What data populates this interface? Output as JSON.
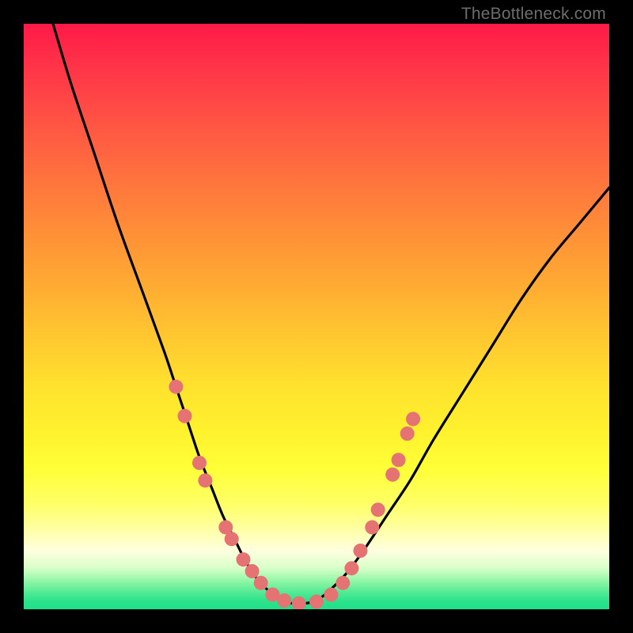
{
  "watermark": "TheBottleneck.com",
  "colors": {
    "page_bg": "#000000",
    "curve_stroke": "#000000",
    "marker_fill": "#e57373",
    "gradient_stops": [
      {
        "pct": 0,
        "color": "#ff1948"
      },
      {
        "pct": 6,
        "color": "#ff2f48"
      },
      {
        "pct": 14,
        "color": "#ff4a46"
      },
      {
        "pct": 24,
        "color": "#ff6b3f"
      },
      {
        "pct": 34,
        "color": "#ff8a38"
      },
      {
        "pct": 44,
        "color": "#ffa933"
      },
      {
        "pct": 54,
        "color": "#ffc930"
      },
      {
        "pct": 62,
        "color": "#ffe22e"
      },
      {
        "pct": 70,
        "color": "#fff22e"
      },
      {
        "pct": 76,
        "color": "#ffff38"
      },
      {
        "pct": 82,
        "color": "#ffff66"
      },
      {
        "pct": 86,
        "color": "#ffffa0"
      },
      {
        "pct": 90,
        "color": "#ffffe0"
      },
      {
        "pct": 93,
        "color": "#d8ffc8"
      },
      {
        "pct": 95,
        "color": "#96f7a8"
      },
      {
        "pct": 97,
        "color": "#56eb96"
      },
      {
        "pct": 98.5,
        "color": "#2de38c"
      },
      {
        "pct": 100,
        "color": "#1ee088"
      }
    ]
  },
  "chart_data": {
    "type": "line",
    "title": "",
    "xlabel": "",
    "ylabel": "",
    "xlim": [
      0,
      100
    ],
    "ylim": [
      0,
      100
    ],
    "note": "V-shaped bottleneck curve. x is normalized horizontal position (0-100 left→right), y is normalized bottleneck percentage (0 at bottom, 100 at top). Values estimated from pixel positions; no axis tick labels shown.",
    "series": [
      {
        "name": "bottleneck_curve",
        "x": [
          5,
          8,
          12,
          16,
          20,
          24,
          26,
          28,
          30,
          32,
          34,
          36,
          38,
          40,
          42,
          44,
          46,
          48,
          50,
          52,
          55,
          58,
          62,
          66,
          70,
          75,
          80,
          85,
          90,
          95,
          100
        ],
        "values": [
          100,
          90,
          78,
          66,
          55,
          44,
          38,
          32,
          26,
          21,
          16,
          12,
          8,
          5,
          3,
          1.5,
          1,
          1,
          1.5,
          3,
          6,
          10,
          16,
          22,
          29,
          37,
          45,
          53,
          60,
          66,
          72
        ]
      }
    ],
    "markers": {
      "name": "highlight_points",
      "note": "Salmon circular markers near the valley of the curve on both arms and along the flat bottom.",
      "points": [
        {
          "x": 26.0,
          "y": 38.0
        },
        {
          "x": 27.5,
          "y": 33.0
        },
        {
          "x": 30.0,
          "y": 25.0
        },
        {
          "x": 31.0,
          "y": 22.0
        },
        {
          "x": 34.5,
          "y": 14.0
        },
        {
          "x": 35.5,
          "y": 12.0
        },
        {
          "x": 37.5,
          "y": 8.5
        },
        {
          "x": 39.0,
          "y": 6.5
        },
        {
          "x": 40.5,
          "y": 4.5
        },
        {
          "x": 42.5,
          "y": 2.5
        },
        {
          "x": 44.5,
          "y": 1.5
        },
        {
          "x": 47.0,
          "y": 1.0
        },
        {
          "x": 50.0,
          "y": 1.3
        },
        {
          "x": 52.5,
          "y": 2.5
        },
        {
          "x": 54.5,
          "y": 4.5
        },
        {
          "x": 56.0,
          "y": 7.0
        },
        {
          "x": 57.5,
          "y": 10.0
        },
        {
          "x": 59.5,
          "y": 14.0
        },
        {
          "x": 60.5,
          "y": 17.0
        },
        {
          "x": 63.0,
          "y": 23.0
        },
        {
          "x": 64.0,
          "y": 25.5
        },
        {
          "x": 65.5,
          "y": 30.0
        },
        {
          "x": 66.5,
          "y": 32.5
        }
      ]
    }
  }
}
